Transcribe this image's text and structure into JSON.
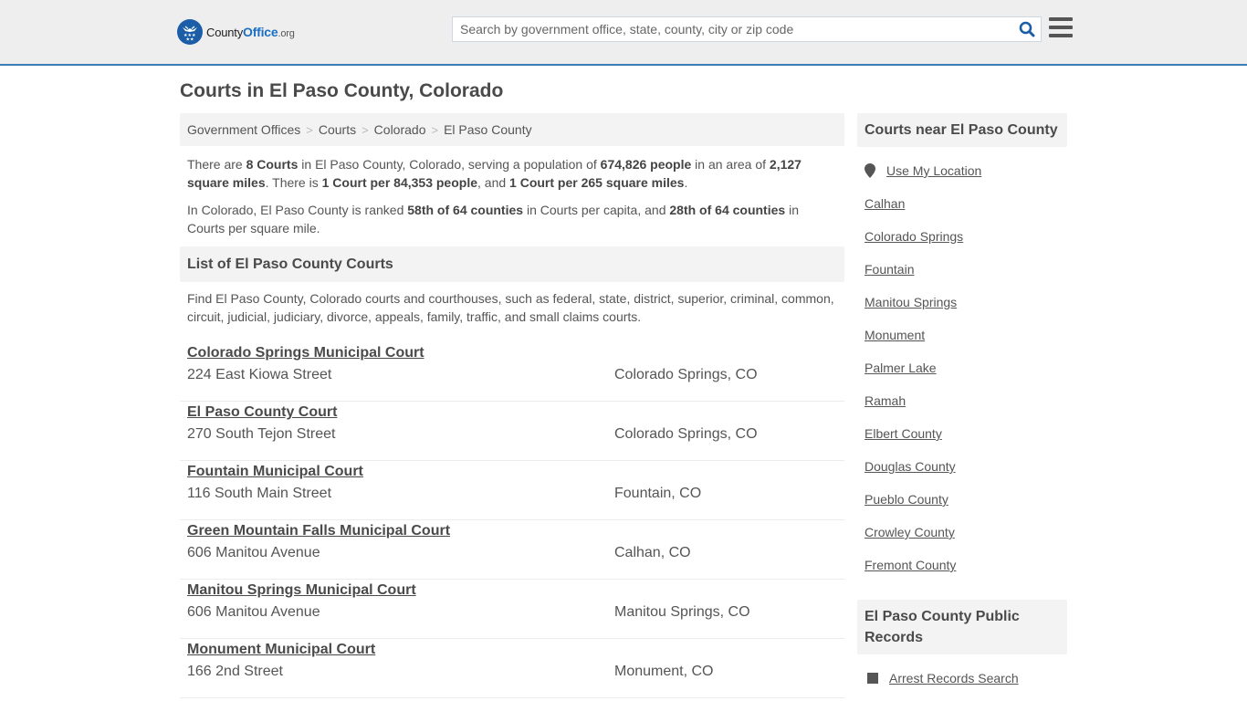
{
  "header": {
    "logo": {
      "prefix": "County",
      "accent": "Office",
      "tld": ".org"
    },
    "search": {
      "placeholder": "Search by government office, state, county, city or zip code",
      "value": ""
    },
    "icons": {
      "search": "search-icon",
      "menu": "hamburger-menu-icon"
    },
    "colors": {
      "brand": "#1b5ea7",
      "border": "#3a7db5"
    }
  },
  "page": {
    "title": "Courts in El Paso County, Colorado"
  },
  "breadcrumb": [
    {
      "label": "Government Offices"
    },
    {
      "label": "Courts"
    },
    {
      "label": "Colorado"
    },
    {
      "label": "El Paso County"
    }
  ],
  "breadcrumb_sep": ">",
  "intro": {
    "p1": {
      "t1": "There are ",
      "b1": "8 Courts",
      "t2": " in El Paso County, Colorado, serving a population of ",
      "b2": "674,826 people",
      "t3": " in an area of ",
      "b3": "2,127 square miles",
      "t4": ". There is ",
      "b4": "1 Court per 84,353 people",
      "t5": ", and ",
      "b5": "1 Court per 265 square miles",
      "t6": "."
    },
    "p2": {
      "t1": "In Colorado, El Paso County is ranked ",
      "b1": "58th of 64 counties",
      "t2": " in Courts per capita, and ",
      "b2": "28th of 64 counties",
      "t3": " in Courts per square mile."
    }
  },
  "list_section": {
    "title": "List of El Paso County Courts",
    "description": "Find El Paso County, Colorado courts and courthouses, such as federal, state, district, superior, criminal, common, circuit, judicial, judiciary, divorce, appeals, family, traffic, and small claims courts."
  },
  "courts": [
    {
      "name": "Colorado Springs Municipal Court",
      "address": "224 East Kiowa Street",
      "city": "Colorado Springs, CO"
    },
    {
      "name": "El Paso County Court",
      "address": "270 South Tejon Street",
      "city": "Colorado Springs, CO"
    },
    {
      "name": "Fountain Municipal Court",
      "address": "116 South Main Street",
      "city": "Fountain, CO"
    },
    {
      "name": "Green Mountain Falls Municipal Court",
      "address": "606 Manitou Avenue",
      "city": "Calhan, CO"
    },
    {
      "name": "Manitou Springs Municipal Court",
      "address": "606 Manitou Avenue",
      "city": "Manitou Springs, CO"
    },
    {
      "name": "Monument Municipal Court",
      "address": "166 2nd Street",
      "city": "Monument, CO"
    }
  ],
  "sidebar": {
    "nearby": {
      "title": "Courts near El Paso County",
      "use_location": "Use My Location",
      "items": [
        "Calhan",
        "Colorado Springs",
        "Fountain",
        "Manitou Springs",
        "Monument",
        "Palmer Lake",
        "Ramah",
        "Elbert County",
        "Douglas County",
        "Pueblo County",
        "Crowley County",
        "Fremont County"
      ]
    },
    "records": {
      "title": "El Paso County Public Records",
      "items": [
        "Arrest Records Search"
      ]
    }
  }
}
